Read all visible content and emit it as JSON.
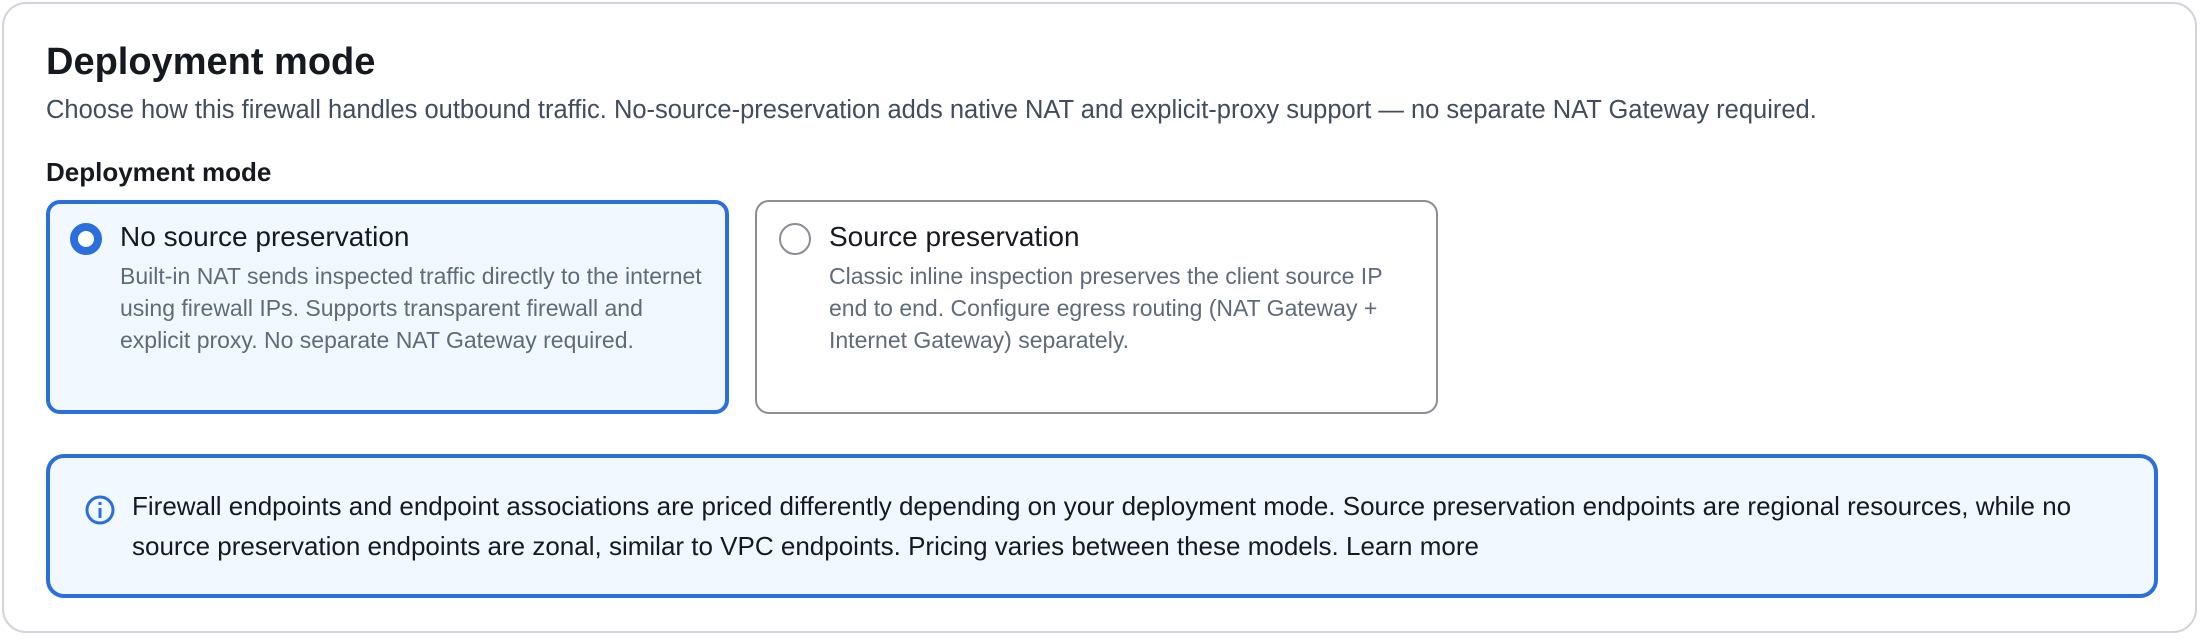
{
  "header": {
    "title": "Deployment mode",
    "description": "Choose how this firewall handles outbound traffic. No-source-preservation adds native NAT and explicit-proxy support — no separate NAT Gateway required."
  },
  "field": {
    "label": "Deployment mode"
  },
  "options": [
    {
      "label": "No source preservation",
      "description": "Built-in NAT sends inspected traffic directly to the internet using firewall IPs. Supports transparent firewall and explicit proxy. No separate NAT Gateway required.",
      "selected": true
    },
    {
      "label": "Source preservation",
      "description": "Classic inline inspection preserves the client source IP end to end. Configure egress routing (NAT Gateway + Internet Gateway) separately.",
      "selected": false
    }
  ],
  "alert": {
    "icon": "info-icon",
    "text": "Firewall endpoints and endpoint associations are priced differently depending on your deployment mode. Source preservation endpoints are regional resources, while no source preservation endpoints are zonal, similar to VPC endpoints. Pricing varies between these models.",
    "link_label": "Learn more"
  },
  "colors": {
    "accent": "#2a6fdb",
    "selected_background": "#f1f8ff",
    "border_muted": "#8c8c94",
    "text_primary": "#16191f",
    "text_secondary": "#5f6b7a"
  }
}
